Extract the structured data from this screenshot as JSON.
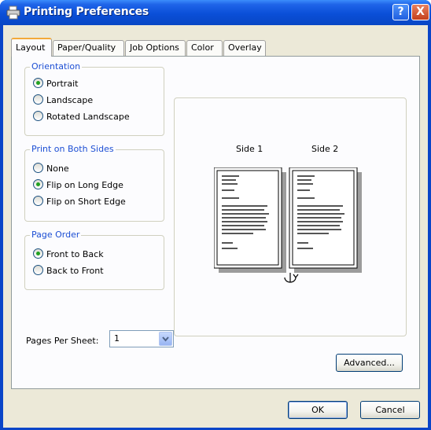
{
  "window": {
    "title": "Printing Preferences",
    "help_label": "?",
    "close_label": "X"
  },
  "tabs": [
    {
      "label": "Layout"
    },
    {
      "label": "Paper/Quality"
    },
    {
      "label": "Job Options"
    },
    {
      "label": "Color"
    },
    {
      "label": "Overlay"
    }
  ],
  "orientation": {
    "label": "Orientation",
    "options": [
      {
        "label": "Portrait",
        "selected": true
      },
      {
        "label": "Landscape",
        "selected": false
      },
      {
        "label": "Rotated Landscape",
        "selected": false
      }
    ]
  },
  "duplex": {
    "label": "Print on Both Sides",
    "options": [
      {
        "label": "None",
        "selected": false
      },
      {
        "label": "Flip on Long Edge",
        "selected": true
      },
      {
        "label": "Flip on Short Edge",
        "selected": false
      }
    ]
  },
  "page_order": {
    "label": "Page Order",
    "options": [
      {
        "label": "Front to Back",
        "selected": true
      },
      {
        "label": "Back to Front",
        "selected": false
      }
    ]
  },
  "pages_per_sheet": {
    "label": "Pages Per Sheet:",
    "value": "1"
  },
  "preview": {
    "side1_label": "Side 1",
    "side2_label": "Side 2",
    "flip_icon": "flip-icon"
  },
  "buttons": {
    "advanced": "Advanced...",
    "ok": "OK",
    "cancel": "Cancel"
  },
  "colors": {
    "accent": "#0a45c8",
    "group_label": "#1d4fd4",
    "tab_highlight": "#f3a93a"
  }
}
